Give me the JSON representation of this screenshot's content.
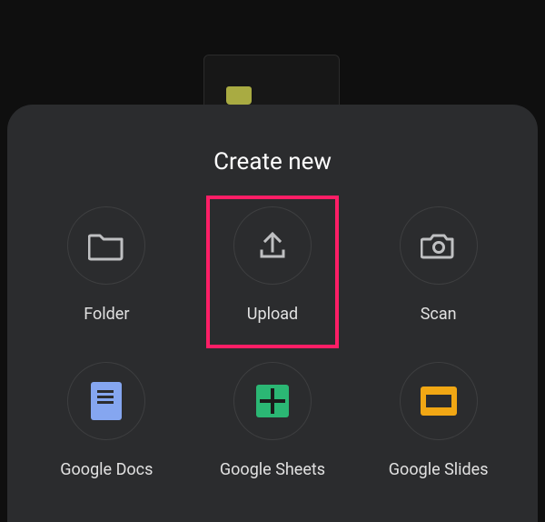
{
  "title": "Create new",
  "options": [
    {
      "id": "folder",
      "label": "Folder"
    },
    {
      "id": "upload",
      "label": "Upload",
      "highlighted": true
    },
    {
      "id": "scan",
      "label": "Scan"
    },
    {
      "id": "docs",
      "label": "Google Docs"
    },
    {
      "id": "sheets",
      "label": "Google Sheets"
    },
    {
      "id": "slides",
      "label": "Google Slides"
    }
  ],
  "colors": {
    "highlight": "#ff1e66",
    "docs": "#85a6f0",
    "sheets": "#2bb774",
    "slides": "#f1a714"
  }
}
